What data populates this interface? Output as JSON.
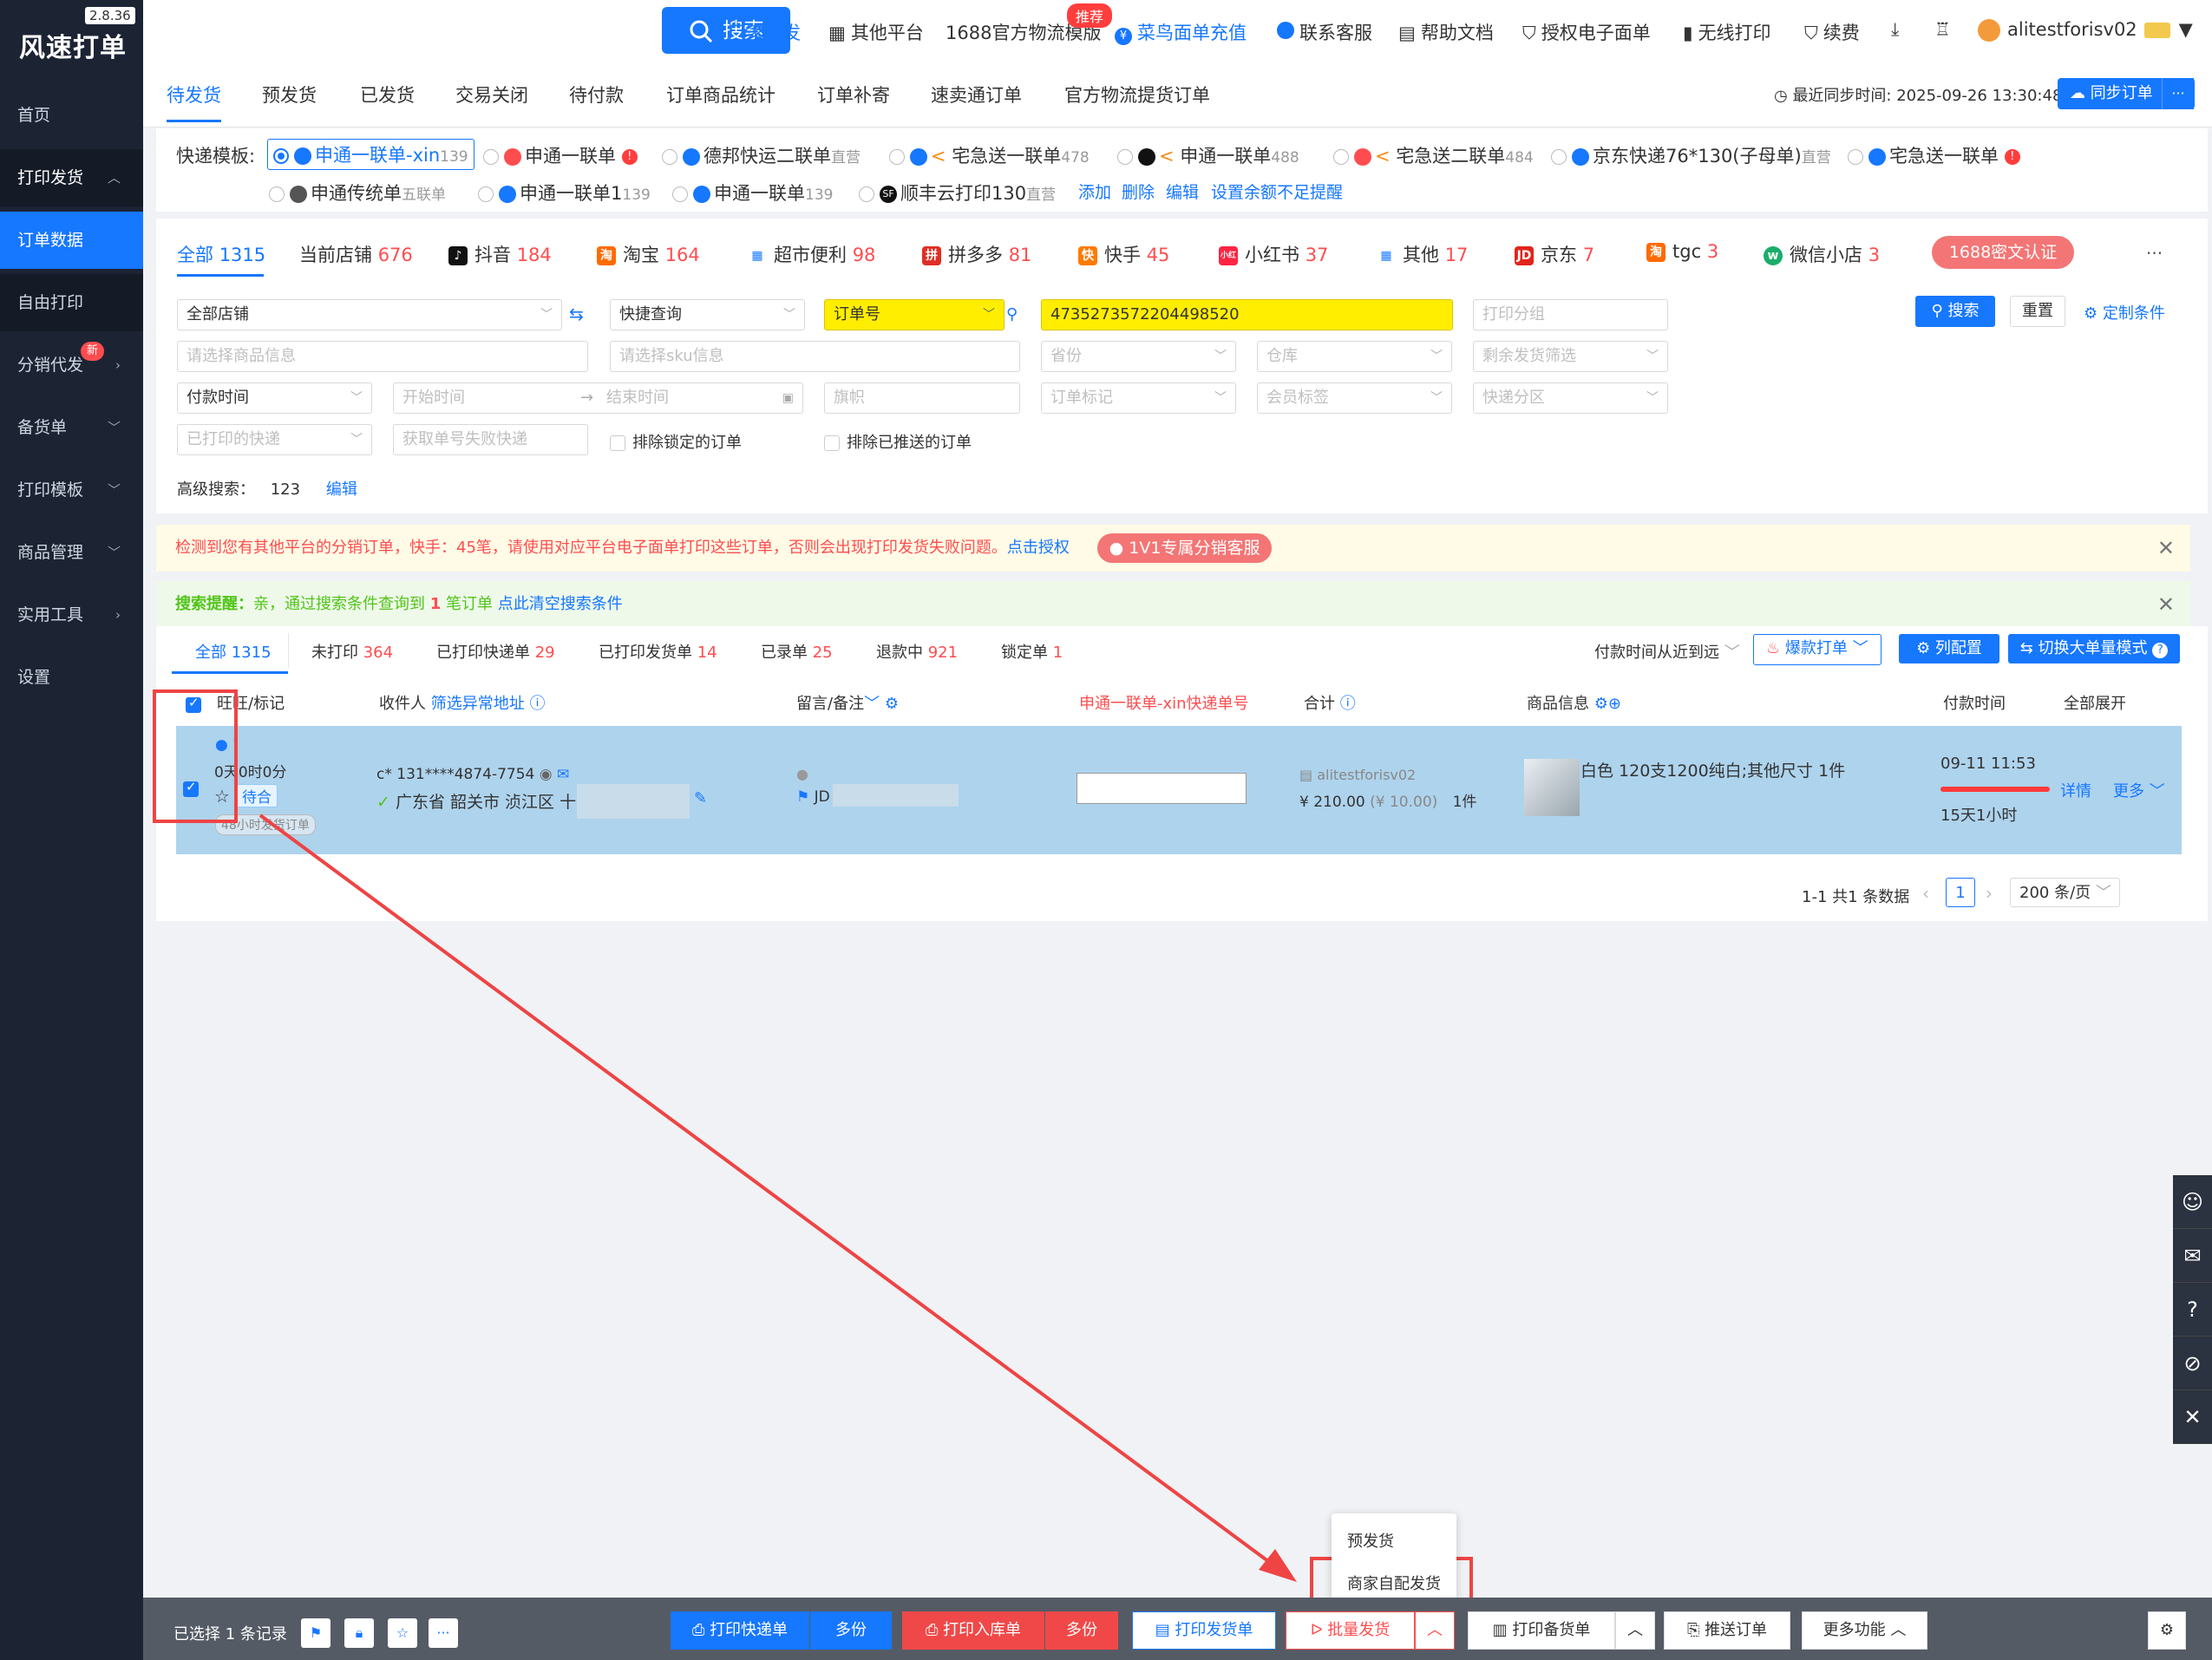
{
  "app": {
    "name": "风速打单",
    "version": "2.8.36"
  },
  "sidebar": {
    "items": [
      {
        "label": "首页"
      },
      {
        "label": "打印发货"
      },
      {
        "label": "订单数据"
      },
      {
        "label": "自由打印"
      },
      {
        "label": "分销代发",
        "badge": "新"
      },
      {
        "label": "备货单"
      },
      {
        "label": "打印模板"
      },
      {
        "label": "商品管理"
      },
      {
        "label": "实用工具"
      },
      {
        "label": "设置"
      }
    ]
  },
  "topbar": {
    "search_label": "搜索",
    "links": [
      "厂家代发",
      "其他平台",
      "1688官方物流模版",
      "菜鸟面单充值",
      "联系客服",
      "帮助文档",
      "授权电子面单",
      "无线打印",
      "续费"
    ],
    "recommend_badge": "推荐",
    "username": "alitestforisv02"
  },
  "main_tabs": [
    "待发货",
    "预发货",
    "已发货",
    "交易关闭",
    "待付款",
    "订单商品统计",
    "订单补寄",
    "速卖通订单",
    "官方物流提货订单"
  ],
  "sync": {
    "last_sync": "最近同步时间: 2025-09-26 13:30:48",
    "button": "同步订单",
    "more": "···"
  },
  "express_templates": {
    "label": "快递模板:",
    "row1": [
      {
        "name": "申通一联单-xin",
        "count": "139"
      },
      {
        "name": "申通一联单",
        "count": ""
      },
      {
        "name": "德邦快运二联单",
        "count": "直营"
      },
      {
        "name": "宅急送一联单",
        "count": "478"
      },
      {
        "name": "申通一联单",
        "count": "488"
      },
      {
        "name": "宅急送二联单",
        "count": "484"
      },
      {
        "name": "京东快递76*130(子母单)",
        "count": "直营"
      },
      {
        "name": "宅急送一联单",
        "count": ""
      }
    ],
    "row2": [
      {
        "name": "申通传统单",
        "count": "五联单"
      },
      {
        "name": "申通一联单1",
        "count": "139"
      },
      {
        "name": "申通一联单",
        "count": "139"
      },
      {
        "name": "顺丰云打印130",
        "count": "直营"
      }
    ],
    "actions": [
      "添加",
      "删除",
      "编辑",
      "设置余额不足提醒"
    ]
  },
  "shop_tabs": [
    {
      "label": "全部",
      "count": "1315"
    },
    {
      "label": "当前店铺",
      "count": "676"
    },
    {
      "label": "抖音",
      "count": "184"
    },
    {
      "label": "淘宝",
      "count": "164"
    },
    {
      "label": "超市便利",
      "count": "98"
    },
    {
      "label": "拼多多",
      "count": "81"
    },
    {
      "label": "快手",
      "count": "45"
    },
    {
      "label": "小红书",
      "count": "37"
    },
    {
      "label": "其他",
      "count": "17"
    },
    {
      "label": "京东",
      "count": "7"
    },
    {
      "label": "tgc",
      "count": "3"
    },
    {
      "label": "微信小店",
      "count": "3"
    }
  ],
  "shop_tab_pill": "1688密文认证",
  "filters": {
    "all_shops": "全部店铺",
    "quick_query": "快捷查询",
    "order_no_type": "订单号",
    "order_no_value": "4735273572204498520",
    "print_group_ph": "打印分组",
    "goods_info_ph": "请选择商品信息",
    "sku_info_ph": "请选择sku信息",
    "province_ph": "省份",
    "warehouse_ph": "仓库",
    "remaining_ph": "剩余发货筛选",
    "pay_time": "付款时间",
    "start_time_ph": "开始时间",
    "end_time_ph": "结束时间",
    "flag_ph": "旗帜",
    "order_mark_ph": "订单标记",
    "member_tag_ph": "会员标签",
    "express_zone_ph": "快递分区",
    "printed_express_ph": "已打印的快递",
    "fail_express_ph": "获取单号失败快递",
    "exclude_locked": "排除锁定的订单",
    "exclude_pushed": "排除已推送的订单",
    "advanced_label": "高级搜索：",
    "advanced_value": "123",
    "advanced_edit": "编辑",
    "search_btn": "搜索",
    "reset_btn": "重置",
    "custom_btn": "定制条件"
  },
  "warning_banner": {
    "text": "检测到您有其他平台的分销订单，快手：45笔，请使用对应平台电子面单打印这些订单，否则会出现打印发货失败问题。",
    "link": "点击授权",
    "pill": "1V1专属分销客服"
  },
  "search_banner": {
    "prefix": "搜索提醒：",
    "text1": "亲，通过搜索条件查询到 ",
    "count": "1",
    "text2": " 笔订单 ",
    "link": "点此清空搜索条件"
  },
  "filter_tabs": [
    {
      "label": "全部",
      "count": "1315"
    },
    {
      "label": "未打印",
      "count": "364"
    },
    {
      "label": "已打印快递单",
      "count": "29"
    },
    {
      "label": "已打印发货单",
      "count": "14"
    },
    {
      "label": "已录单",
      "count": "25"
    },
    {
      "label": "退款中",
      "count": "921"
    },
    {
      "label": "锁定单",
      "count": "1"
    }
  ],
  "list_controls": {
    "sort": "付款时间从近到远",
    "hot_print": "爆款打单",
    "col_config": "列配置",
    "switch_mode": "切换大单量模式"
  },
  "table": {
    "headers": {
      "flag": "旺旺/标记",
      "receiver": "收件人",
      "filter_addr": "筛选异常地址",
      "remark": "留言/备注",
      "express_no": "申通一联单-xin快递单号",
      "total": "合计",
      "goods": "商品信息",
      "pay_time": "付款时间",
      "expand_all": "全部展开"
    },
    "row": {
      "wang": "'",
      "countdown": "0天0时0分",
      "tag": "待合",
      "note48": "48小时发货订单",
      "phone": "c* 131****4874-7754",
      "address": "广东省 韶关市 浈江区 十",
      "remark_jd": "JD",
      "shop": "alitestforisv02",
      "amount": "¥ 210.00",
      "unit_price": "(¥ 10.00)",
      "qty": "1件",
      "goods_desc": "白色 120支1200纯白;其他尺寸 1件",
      "pay_time": "09-11 11:53",
      "remain": "15天1小时",
      "detail": "详情",
      "more": "更多"
    }
  },
  "pagination": {
    "summary": "1-1 共1 条数据",
    "page": "1",
    "page_size": "200 条/页"
  },
  "popup_menu": [
    "预发货",
    "商家自配发货"
  ],
  "bottom_bar": {
    "selected": "已选择 1 条记录",
    "print_express": "打印快递单",
    "multi1": "多份",
    "print_stock_in": "打印入库单",
    "multi2": "多份",
    "print_ship": "打印发货单",
    "batch_ship": "批量发货",
    "print_prep": "打印备货单",
    "push_order": "推送订单",
    "more_func": "更多功能"
  },
  "colors": {
    "brand": "#1677ff",
    "sidebar": "#1c2434",
    "danger": "#ff4d4f",
    "annotation": "#ee4444",
    "row_selected": "#aed3ed",
    "highlight": "#ffee00"
  }
}
